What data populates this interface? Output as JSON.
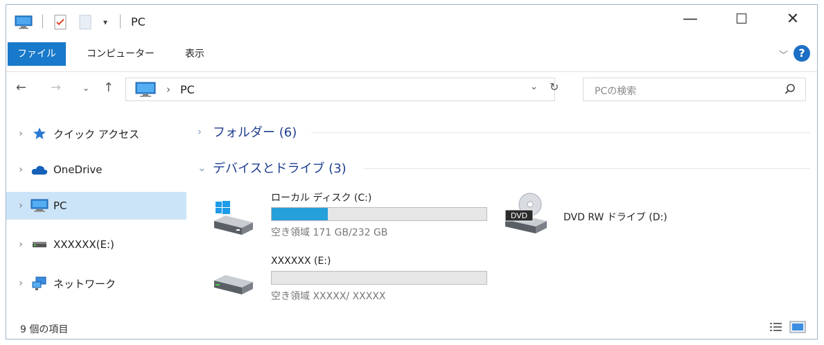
{
  "window": {
    "title": "PC",
    "controls": {
      "minimize": "—",
      "maximize": "☐",
      "close": "✕"
    }
  },
  "ribbon": {
    "tabs": [
      {
        "label": "ファイル",
        "active": true
      },
      {
        "label": "コンピューター",
        "active": false
      },
      {
        "label": "表示",
        "active": false
      }
    ],
    "help": "?"
  },
  "address": {
    "path": "PC",
    "search_placeholder": "PCの検索"
  },
  "nav_pane": {
    "items": [
      {
        "label": "クイック アクセス",
        "icon": "star-icon"
      },
      {
        "label": "OneDrive",
        "icon": "cloud-icon"
      },
      {
        "label": "PC",
        "icon": "computer-icon",
        "selected": true
      },
      {
        "label": "XXXXXX(E:)",
        "icon": "drive-icon"
      },
      {
        "label": "ネットワーク",
        "icon": "network-icon"
      }
    ]
  },
  "content": {
    "groups": [
      {
        "label": "フォルダー (6)",
        "expanded": false
      },
      {
        "label": "デバイスとドライブ (3)",
        "expanded": true
      }
    ],
    "drives": [
      {
        "name": "ローカル ディスク (C:)",
        "space": "空き領域 171 GB/232 GB",
        "used_fraction": 0.26,
        "icon": "windows-drive-icon"
      },
      {
        "name": "XXXXXX (E:)",
        "space": "空き領域 XXXXX/ XXXXX",
        "used_fraction": 0,
        "icon": "drive-icon"
      },
      {
        "name": "DVD RW ドライブ (D:)",
        "icon": "dvd-drive-icon",
        "badge": "DVD"
      }
    ]
  },
  "status_bar": {
    "count": "9 個の項目"
  },
  "colors": {
    "accent": "#1979ca",
    "selection": "#cce4f7",
    "bar_fill": "#26a0da",
    "group_text": "#1e3d8f"
  }
}
